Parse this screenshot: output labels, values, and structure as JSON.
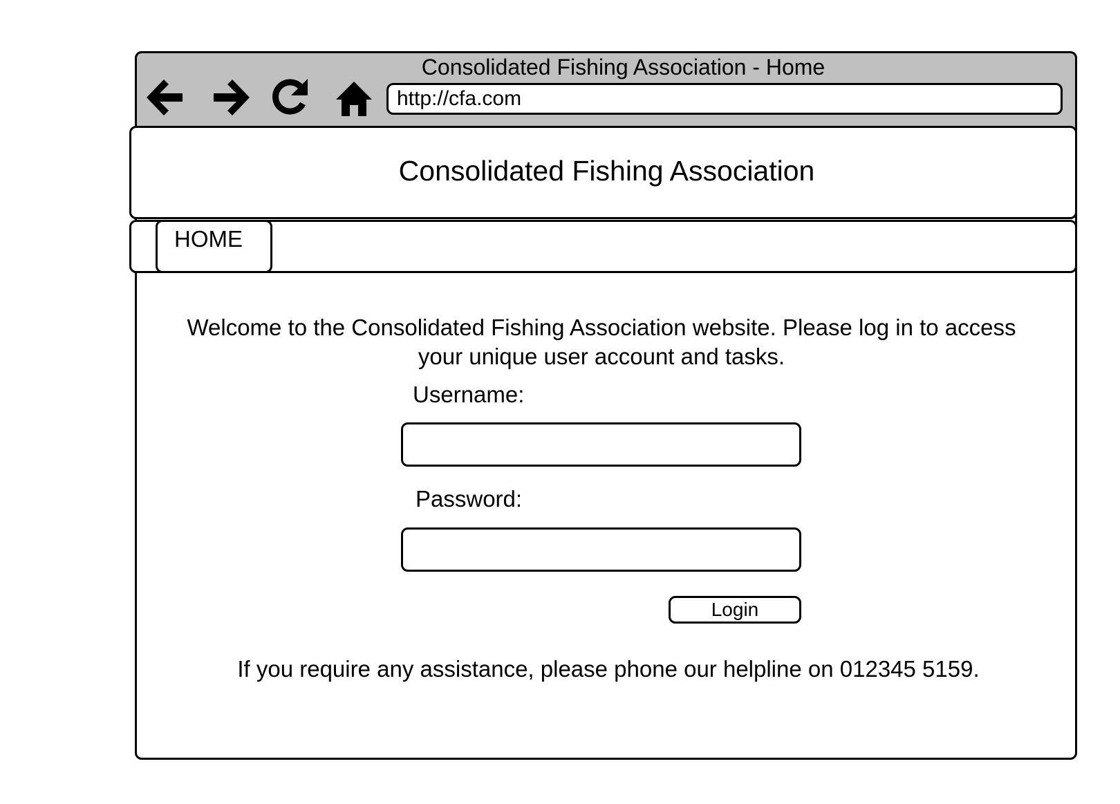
{
  "browser": {
    "window_title": "Consolidated Fishing Association - Home",
    "url": "http://cfa.com",
    "nav_icons": [
      "back-arrow-icon",
      "forward-arrow-icon",
      "reload-icon",
      "home-icon"
    ]
  },
  "site": {
    "title": "Consolidated Fishing Association"
  },
  "nav": {
    "tabs": [
      {
        "label": "HOME"
      }
    ]
  },
  "main": {
    "welcome_text": "Welcome to the Consolidated Fishing Association website. Please log in to access your unique user account and tasks.",
    "username_label": "Username:",
    "username_value": "",
    "password_label": "Password:",
    "password_value": "",
    "login_label": "Login",
    "helpline_text": "If you require any assistance, please phone our helpline on 012345 5159."
  }
}
